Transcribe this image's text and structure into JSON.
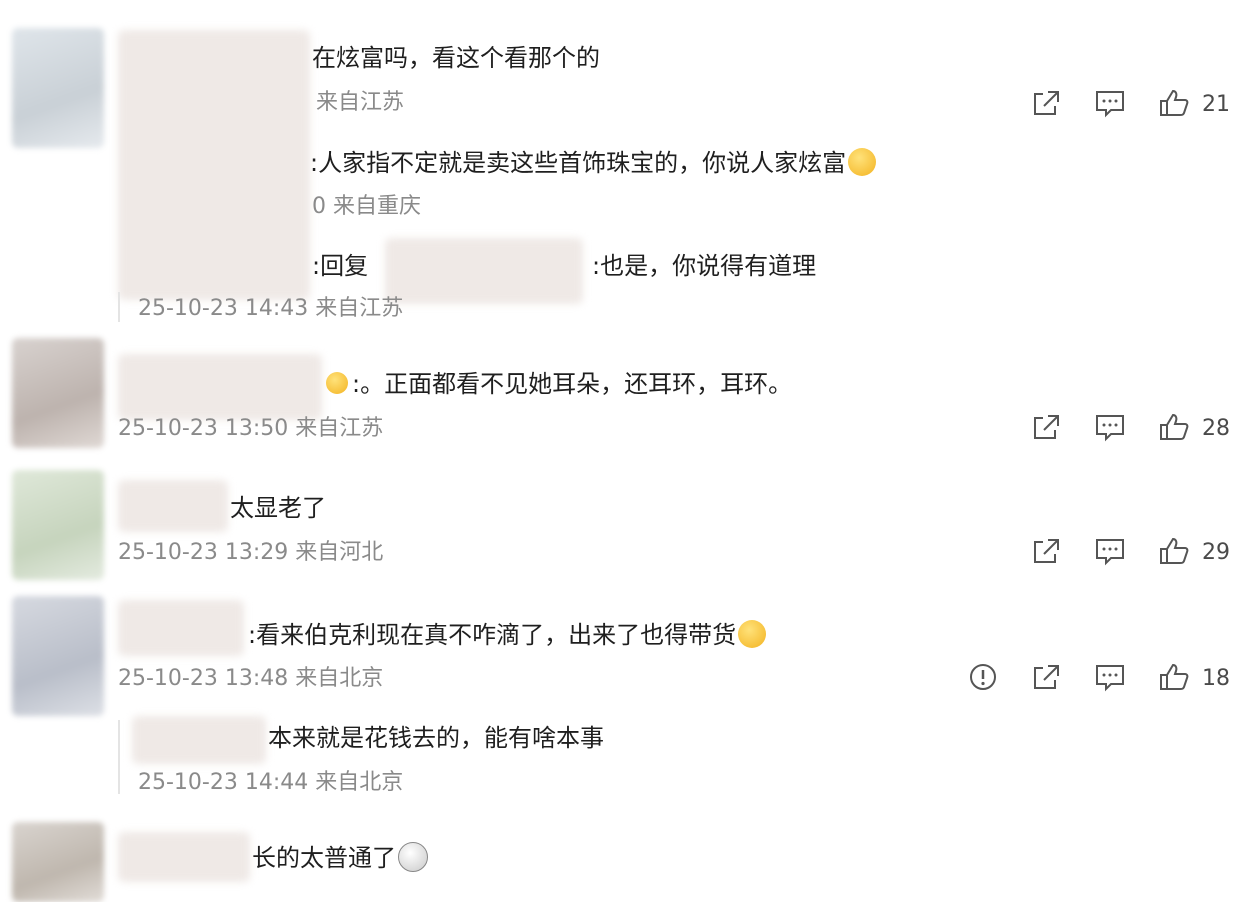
{
  "comments": [
    {
      "content": "在炫富吗，看这个看那个的",
      "meta": "来自江苏",
      "share_icon": "share-icon",
      "reply_icon": "comment-icon",
      "like_icon": "thumbs-up-icon",
      "likes": "21"
    },
    {
      "content": ":人家指不定就是卖这些首饰珠宝的，你说人家炫富",
      "emoji": "laughing-crying-emoji",
      "meta": "0 来自重庆"
    },
    {
      "content_prefix": ":回复",
      "content": ":也是，你说得有道理",
      "meta": "25-10-23 14:43 来自江苏"
    },
    {
      "emoji": "gift-emoji",
      "content": ":。正面都看不见她耳朵，还耳环，耳环。",
      "meta": "25-10-23 13:50 来自江苏",
      "likes": "28"
    },
    {
      "content": "太显老了",
      "meta": "25-10-23 13:29 来自河北",
      "likes": "29"
    },
    {
      "content": ":看来伯克利现在真不咋滴了，出来了也得带货",
      "emoji": "dog-emoji",
      "meta": "25-10-23 13:48 来自北京",
      "report_icon": "report-icon",
      "likes": "18"
    },
    {
      "content": "本来就是花钱去的，能有啥本事",
      "meta": "25-10-23 14:44 来自北京"
    },
    {
      "content": "长的太普通了",
      "emoji": "shocked-emoji"
    }
  ],
  "colors": {
    "text": "#1f1f1f",
    "meta": "#8a8a8a",
    "icon": "#555555",
    "background": "#ffffff"
  }
}
